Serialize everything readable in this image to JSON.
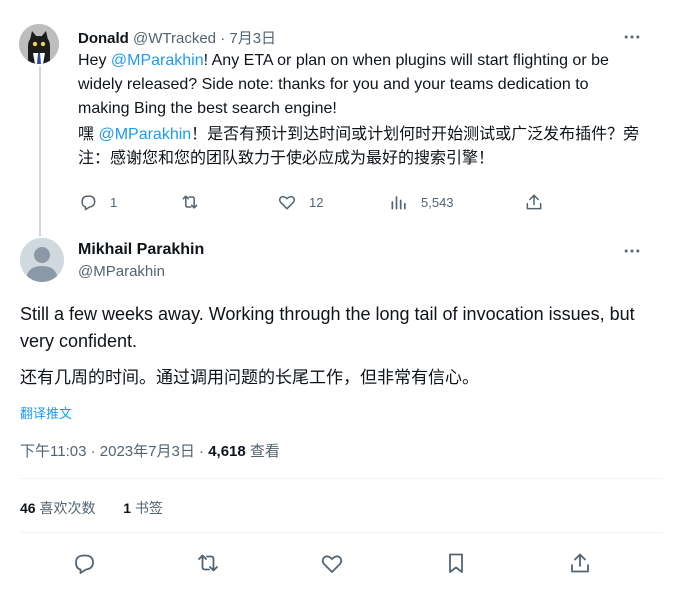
{
  "reply": {
    "author_name": "Donald",
    "handle": "@WTracked",
    "sep": " · ",
    "date": "7月3日",
    "text_prefix": "Hey ",
    "mention": "@MParakhin",
    "text_en": "! Any ETA or plan on when plugins will start flighting or be widely released? Side note: thanks for you and your teams dedication to making Bing the best search engine!",
    "text_cn_prefix": "嘿 ",
    "mention_cn": "@MParakhin",
    "text_cn": "！是否有预计到达时间或计划何时开始测试或广泛发布插件？旁注：感谢您和您的团队致力于使必应成为最好的搜索引擎！",
    "actions": {
      "replies": "1",
      "retweets": "",
      "likes": "12",
      "views": "5,543"
    }
  },
  "main": {
    "author_name": "Mikhail Parakhin",
    "handle": "@MParakhin",
    "text_en": "Still a few weeks away. Working through the long tail of invocation issues, but very confident.",
    "text_cn": "还有几周的时间。通过调用问题的长尾工作，但非常有信心。",
    "translate_label": "翻译推文",
    "time": "下午11:03",
    "date": "2023年7月3日",
    "views_count": "4,618",
    "views_label": "查看",
    "likes_count": "46",
    "likes_label": "喜欢次数",
    "bookmarks_count": "1",
    "bookmarks_label": "书签"
  },
  "icons": {
    "more": "more-dots-icon",
    "reply": "reply-icon",
    "retweet": "retweet-icon",
    "like": "heart-icon",
    "views": "views-chart-icon",
    "share": "share-icon",
    "bookmark": "bookmark-icon"
  },
  "colors": {
    "link": "#1d9bf0",
    "muted": "#536471",
    "text": "#0f1419",
    "divider": "#eff3f4"
  }
}
